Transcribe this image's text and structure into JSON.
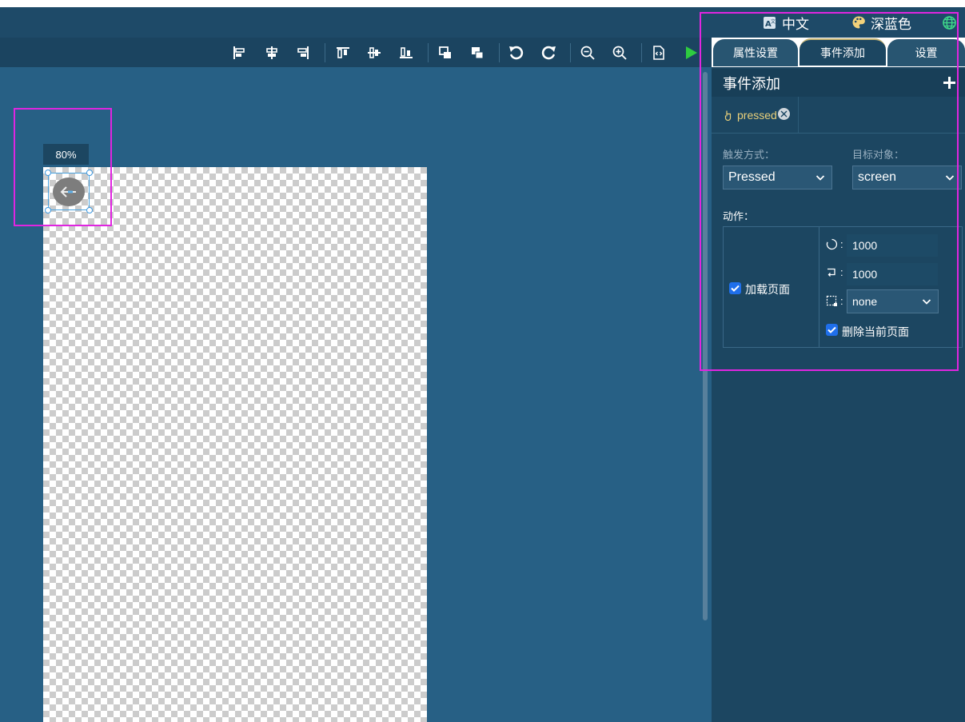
{
  "topbar": {
    "language_label": "中文",
    "theme_label": "深蓝色"
  },
  "canvas": {
    "zoom": "80%"
  },
  "panel": {
    "tabs": [
      {
        "label": "属性设置"
      },
      {
        "label": "事件添加"
      },
      {
        "label": "设置"
      }
    ],
    "section_title": "事件添加",
    "event_tab_label": "pressed",
    "trigger_label": "触发方式：",
    "trigger_value": "Pressed",
    "target_label": "目标对象：",
    "target_value": "screen",
    "action_label": "动作：",
    "load_page_label": "加载页面",
    "time_value": "1000",
    "delay_value": "1000",
    "anim_value": "none",
    "delete_page_label": "删除当前页面"
  },
  "colors": {
    "accent_highlight": "#e025e0",
    "play": "#2ecc40",
    "checkbox": "#1f6feb"
  }
}
